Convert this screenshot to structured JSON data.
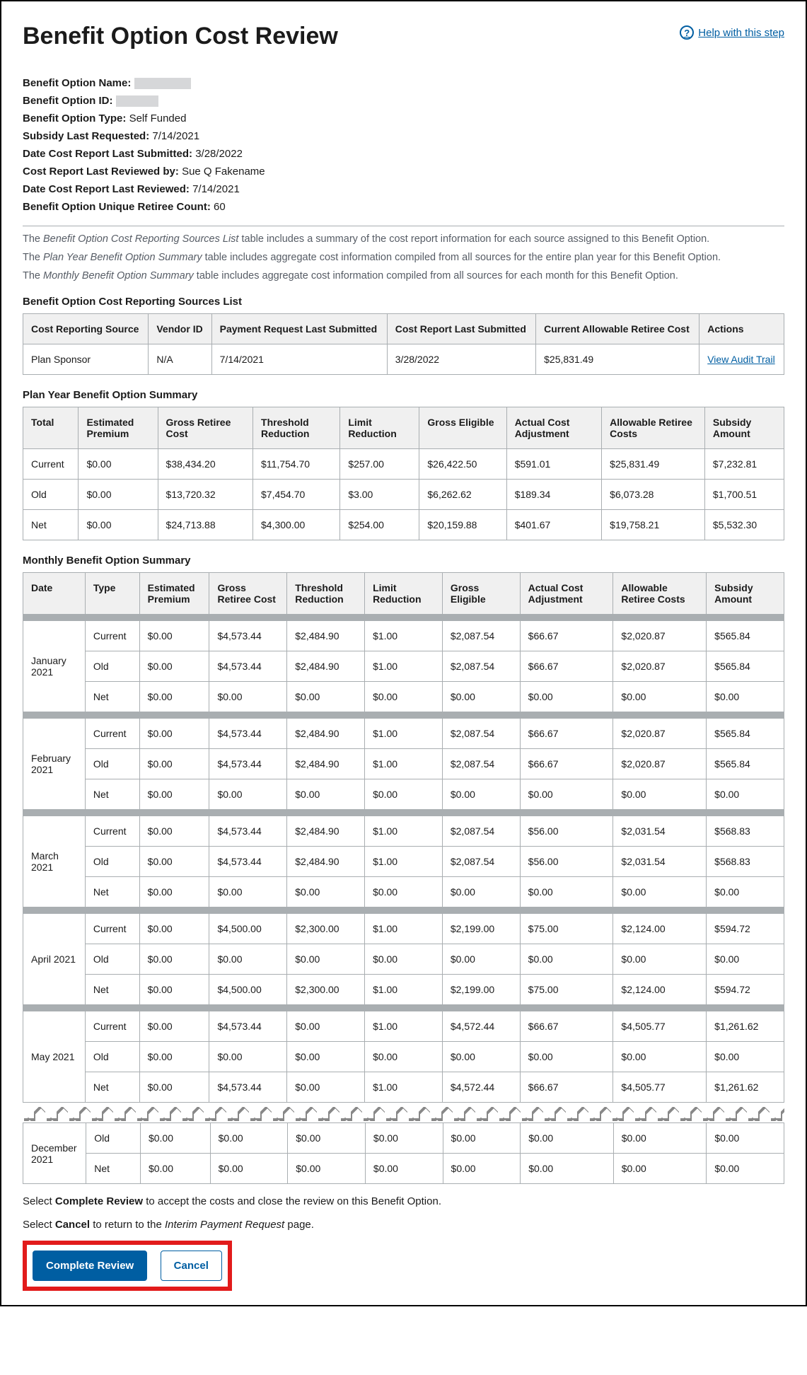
{
  "header": {
    "title": "Benefit Option Cost Review",
    "help_label": " Help with this step"
  },
  "meta": {
    "name_label": "Benefit Option Name:",
    "id_label": "Benefit Option ID:",
    "type_label": "Benefit Option Type:",
    "type_value": "Self Funded",
    "subsidy_label": "Subsidy Last Requested:",
    "subsidy_value": "7/14/2021",
    "date_cost_sub_label": "Date Cost Report Last Submitted:",
    "date_cost_sub_value": "3/28/2022",
    "reviewed_by_label": "Cost Report Last Reviewed by:",
    "reviewed_by_value": "Sue Q Fakename",
    "date_reviewed_label": "Date Cost Report Last Reviewed:",
    "date_reviewed_value": "7/14/2021",
    "retiree_count_label": "Benefit Option Unique Retiree Count:",
    "retiree_count_value": "60"
  },
  "paras": {
    "p1_a": "The ",
    "p1_i": "Benefit Option Cost Reporting Sources List",
    "p1_b": " table includes a summary of the cost report information for each source assigned to this Benefit Option.",
    "p2_a": "The ",
    "p2_i": "Plan Year Benefit Option Summary",
    "p2_b": " table includes aggregate cost information compiled from all sources for the entire plan year for this Benefit Option.",
    "p3_a": "The ",
    "p3_i": "Monthly Benefit Option Summary",
    "p3_b": " table includes aggregate cost information compiled from all sources for each month for this Benefit Option."
  },
  "sources": {
    "title": "Benefit Option Cost Reporting Sources List",
    "headers": {
      "c1": "Cost Reporting Source",
      "c2": "Vendor ID",
      "c3": "Payment Request Last Submitted",
      "c4": "Cost Report Last Submitted",
      "c5": "Current Allowable Retiree Cost",
      "c6": "Actions"
    },
    "row": {
      "c1": "Plan Sponsor",
      "c2": "N/A",
      "c3": "7/14/2021",
      "c4": "3/28/2022",
      "c5": "$25,831.49",
      "action": "View Audit Trail"
    }
  },
  "planyear": {
    "title": "Plan Year Benefit Option Summary",
    "headers": {
      "c1": "Total",
      "c2": "Estimated Premium",
      "c3": "Gross Retiree Cost",
      "c4": "Threshold Reduction",
      "c5": "Limit Reduction",
      "c6": "Gross Eligible",
      "c7": "Actual Cost Adjustment",
      "c8": "Allowable Retiree Costs",
      "c9": "Subsidy Amount"
    },
    "rows": [
      {
        "c1": "Current",
        "c2": "$0.00",
        "c3": "$38,434.20",
        "c4": "$11,754.70",
        "c5": "$257.00",
        "c6": "$26,422.50",
        "c7": "$591.01",
        "c8": "$25,831.49",
        "c9": "$7,232.81"
      },
      {
        "c1": "Old",
        "c2": "$0.00",
        "c3": "$13,720.32",
        "c4": "$7,454.70",
        "c5": "$3.00",
        "c6": "$6,262.62",
        "c7": "$189.34",
        "c8": "$6,073.28",
        "c9": "$1,700.51"
      },
      {
        "c1": "Net",
        "c2": "$0.00",
        "c3": "$24,713.88",
        "c4": "$4,300.00",
        "c5": "$254.00",
        "c6": "$20,159.88",
        "c7": "$401.67",
        "c8": "$19,758.21",
        "c9": "$5,532.30"
      }
    ]
  },
  "monthly": {
    "title": "Monthly Benefit Option Summary",
    "headers": {
      "c1": "Date",
      "c2": "Type",
      "c3": "Estimated Premium",
      "c4": "Gross Retiree Cost",
      "c5": "Threshold Reduction",
      "c6": "Limit Reduction",
      "c7": "Gross Eligible",
      "c8": "Actual Cost Adjustment",
      "c9": "Allowable Retiree Costs",
      "c10": "Subsidy Amount"
    },
    "months": [
      {
        "date": "January 2021",
        "rows": [
          {
            "type": "Current",
            "ep": "$0.00",
            "grc": "$4,573.44",
            "tr": "$2,484.90",
            "lr": "$1.00",
            "ge": "$2,087.54",
            "aca": "$66.67",
            "arc": "$2,020.87",
            "sa": "$565.84"
          },
          {
            "type": "Old",
            "ep": "$0.00",
            "grc": "$4,573.44",
            "tr": "$2,484.90",
            "lr": "$1.00",
            "ge": "$2,087.54",
            "aca": "$66.67",
            "arc": "$2,020.87",
            "sa": "$565.84"
          },
          {
            "type": "Net",
            "ep": "$0.00",
            "grc": "$0.00",
            "tr": "$0.00",
            "lr": "$0.00",
            "ge": "$0.00",
            "aca": "$0.00",
            "arc": "$0.00",
            "sa": "$0.00"
          }
        ]
      },
      {
        "date": "February 2021",
        "rows": [
          {
            "type": "Current",
            "ep": "$0.00",
            "grc": "$4,573.44",
            "tr": "$2,484.90",
            "lr": "$1.00",
            "ge": "$2,087.54",
            "aca": "$66.67",
            "arc": "$2,020.87",
            "sa": "$565.84"
          },
          {
            "type": "Old",
            "ep": "$0.00",
            "grc": "$4,573.44",
            "tr": "$2,484.90",
            "lr": "$1.00",
            "ge": "$2,087.54",
            "aca": "$66.67",
            "arc": "$2,020.87",
            "sa": "$565.84"
          },
          {
            "type": "Net",
            "ep": "$0.00",
            "grc": "$0.00",
            "tr": "$0.00",
            "lr": "$0.00",
            "ge": "$0.00",
            "aca": "$0.00",
            "arc": "$0.00",
            "sa": "$0.00"
          }
        ]
      },
      {
        "date": "March 2021",
        "rows": [
          {
            "type": "Current",
            "ep": "$0.00",
            "grc": "$4,573.44",
            "tr": "$2,484.90",
            "lr": "$1.00",
            "ge": "$2,087.54",
            "aca": "$56.00",
            "arc": "$2,031.54",
            "sa": "$568.83"
          },
          {
            "type": "Old",
            "ep": "$0.00",
            "grc": "$4,573.44",
            "tr": "$2,484.90",
            "lr": "$1.00",
            "ge": "$2,087.54",
            "aca": "$56.00",
            "arc": "$2,031.54",
            "sa": "$568.83"
          },
          {
            "type": "Net",
            "ep": "$0.00",
            "grc": "$0.00",
            "tr": "$0.00",
            "lr": "$0.00",
            "ge": "$0.00",
            "aca": "$0.00",
            "arc": "$0.00",
            "sa": "$0.00"
          }
        ]
      },
      {
        "date": "April 2021",
        "rows": [
          {
            "type": "Current",
            "ep": "$0.00",
            "grc": "$4,500.00",
            "tr": "$2,300.00",
            "lr": "$1.00",
            "ge": "$2,199.00",
            "aca": "$75.00",
            "arc": "$2,124.00",
            "sa": "$594.72"
          },
          {
            "type": "Old",
            "ep": "$0.00",
            "grc": "$0.00",
            "tr": "$0.00",
            "lr": "$0.00",
            "ge": "$0.00",
            "aca": "$0.00",
            "arc": "$0.00",
            "sa": "$0.00"
          },
          {
            "type": "Net",
            "ep": "$0.00",
            "grc": "$4,500.00",
            "tr": "$2,300.00",
            "lr": "$1.00",
            "ge": "$2,199.00",
            "aca": "$75.00",
            "arc": "$2,124.00",
            "sa": "$594.72"
          }
        ]
      },
      {
        "date": "May 2021",
        "rows": [
          {
            "type": "Current",
            "ep": "$0.00",
            "grc": "$4,573.44",
            "tr": "$0.00",
            "lr": "$1.00",
            "ge": "$4,572.44",
            "aca": "$66.67",
            "arc": "$4,505.77",
            "sa": "$1,261.62"
          },
          {
            "type": "Old",
            "ep": "$0.00",
            "grc": "$0.00",
            "tr": "$0.00",
            "lr": "$0.00",
            "ge": "$0.00",
            "aca": "$0.00",
            "arc": "$0.00",
            "sa": "$0.00"
          },
          {
            "type": "Net",
            "ep": "$0.00",
            "grc": "$4,573.44",
            "tr": "$0.00",
            "lr": "$1.00",
            "ge": "$4,572.44",
            "aca": "$66.67",
            "arc": "$4,505.77",
            "sa": "$1,261.62"
          }
        ]
      }
    ],
    "dec": {
      "date": "December 2021",
      "rows": [
        {
          "type": "Old",
          "ep": "$0.00",
          "grc": "$0.00",
          "tr": "$0.00",
          "lr": "$0.00",
          "ge": "$0.00",
          "aca": "$0.00",
          "arc": "$0.00",
          "sa": "$0.00"
        },
        {
          "type": "Net",
          "ep": "$0.00",
          "grc": "$0.00",
          "tr": "$0.00",
          "lr": "$0.00",
          "ge": "$0.00",
          "aca": "$0.00",
          "arc": "$0.00",
          "sa": "$0.00"
        }
      ]
    }
  },
  "instructions": {
    "i1_a": "Select ",
    "i1_b": "Complete Review",
    "i1_c": " to accept the costs and close the review on this Benefit Option.",
    "i2_a": "Select ",
    "i2_b": "Cancel",
    "i2_c": " to return to the ",
    "i2_d": "Interim Payment Request",
    "i2_e": " page."
  },
  "buttons": {
    "complete": "Complete Review",
    "cancel": "Cancel"
  }
}
